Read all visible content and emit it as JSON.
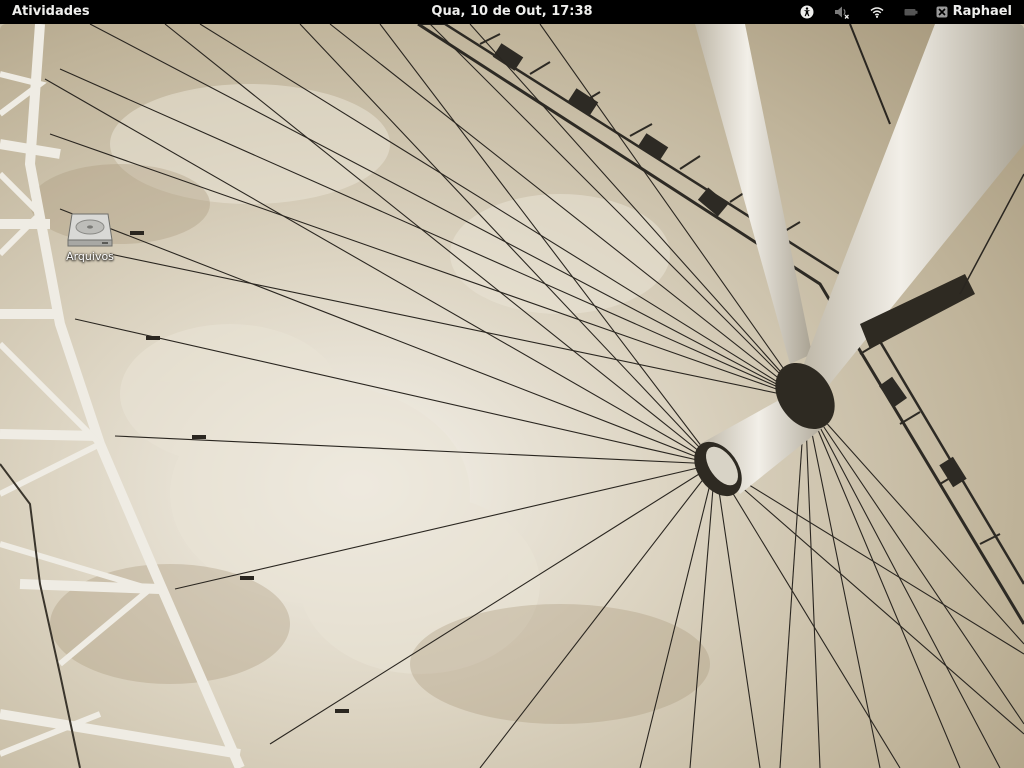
{
  "top_bar": {
    "activities_label": "Atividades",
    "clock_label": "Qua, 10 de Out, 17:38",
    "status_icons": [
      "accessibility-icon",
      "volume-muted-icon",
      "wifi-icon",
      "battery-icon"
    ],
    "user_name": "Raphael"
  },
  "desktop": {
    "icons": [
      {
        "label": "Arquivos",
        "icon": "hard-disk-icon"
      }
    ]
  },
  "colors": {
    "panel_background": "#000000",
    "panel_text": "#eeeeec",
    "wallpaper_sky": "#c9bfa8",
    "wallpaper_structure": "#ece8de"
  }
}
